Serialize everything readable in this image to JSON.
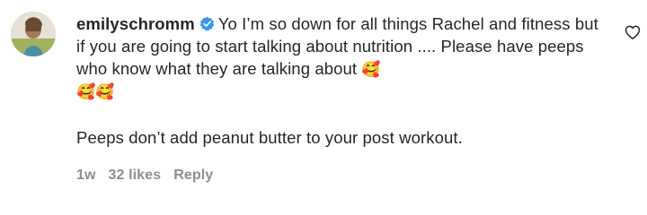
{
  "comment": {
    "username": "emilyschromm",
    "verified": true,
    "text_line1": "Yo I’m so down for all things Rachel and fitness but if you are going to start talking about nutrition .... Please have peeps who know what they are talking about",
    "emoji_inline": "🥰",
    "emoji_line2": "🥰🥰",
    "text_paragraph2": "Peeps don’t add peanut butter to your post workout.",
    "time": "1w",
    "likes": "32 likes",
    "reply_label": "Reply",
    "like_icon": "heart-outline-icon"
  },
  "colors": {
    "text": "#262626",
    "meta": "#8e8e8e",
    "verified_badge": "#3897f0"
  }
}
